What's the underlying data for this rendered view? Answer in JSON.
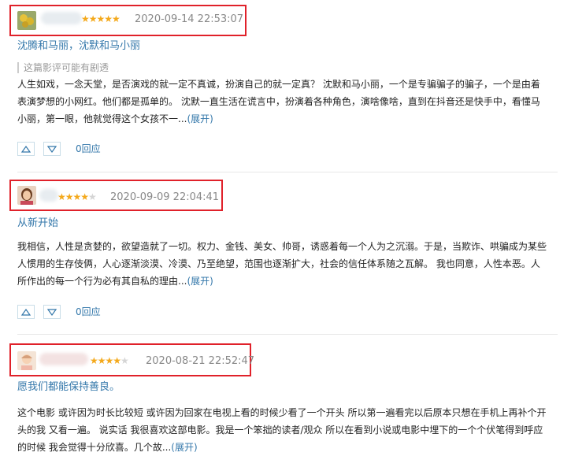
{
  "reviews": [
    {
      "rating": 5,
      "stars": "★★★★★",
      "time": "2020-09-14 22:53:07",
      "title": "沈腾和马丽，沈默和马小丽",
      "spoiler": "这篇影评可能有剧透",
      "body": "人生如戏，一念天堂，是否演戏的就一定不真诚，扮演自己的就一定真？ 沈默和马小丽，一个是专骗骗子的骗子，一个是由着表演梦想的小网红。他们都是孤单的。 沈默一直生活在谎言中，扮演着各种角色，演啥像啥，直到在抖音还是快手中，看懂马小丽，第一眼，他就觉得这个女孩不一...",
      "expand": "(展开)",
      "reply": "0回应"
    },
    {
      "rating": 4,
      "stars_on": "★★★★",
      "stars_off": "★",
      "time": "2020-09-09 22:04:41",
      "title": "从新开始",
      "body": "我相信，人性是贪婪的，欲望造就了一切。权力、金钱、美女、帅哥，诱惑着每一个人为之沉溺。于是，当欺诈、哄骗成为某些人惯用的生存伎俩，人心逐渐淡漠、冷漠、乃至绝望，范围也逐渐扩大，社会的信任体系随之瓦解。 我也同意，人性本恶。人所作出的每一个行为必有其自私的理由...",
      "expand": "(展开)",
      "reply": "0回应"
    },
    {
      "rating": 4,
      "stars_on": "★★★★",
      "stars_off": "★",
      "time": "2020-08-21 22:52:47",
      "title": "愿我们都能保持善良。",
      "body": "这个电影 或许因为时长比较短 或许因为回家在电视上看的时候少看了一个开头 所以第一遍看完以后原本只想在手机上再补个开头的我 又看一遍。 说实话 我很喜欢这部电影。我是一个笨拙的读者/观众 所以在看到小说或电影中埋下的一个个伏笔得到呼应的时候 我会觉得十分欣喜。几个故...",
      "expand": "(展开)"
    }
  ]
}
